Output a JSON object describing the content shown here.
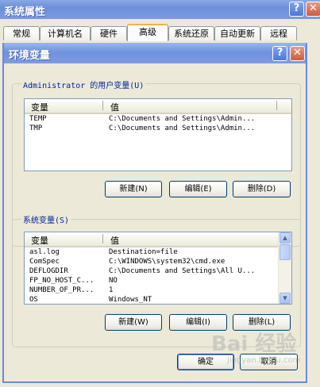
{
  "outer": {
    "title": "系统属性",
    "help": "?",
    "close": "✕",
    "tabs": [
      "常规",
      "计算机名",
      "硬件",
      "高级",
      "系统还原",
      "自动更新",
      "远程"
    ]
  },
  "dialog": {
    "title": "环境变量",
    "help": "?",
    "close": "✕",
    "user_group_label": "Administrator 的用户变量(U)",
    "system_group_label": "系统变量(S)",
    "columns": {
      "name": "变量",
      "value": "值"
    },
    "user_vars": [
      {
        "name": "TEMP",
        "value": "C:\\Documents and Settings\\Admin..."
      },
      {
        "name": "TMP",
        "value": "C:\\Documents and Settings\\Admin..."
      }
    ],
    "system_vars": [
      {
        "name": "asl.log",
        "value": "Destination=file"
      },
      {
        "name": "ComSpec",
        "value": "C:\\WINDOWS\\system32\\cmd.exe"
      },
      {
        "name": "DEFLOGDIR",
        "value": "C:\\Documents and Settings\\All U..."
      },
      {
        "name": "FP_NO_HOST_C...",
        "value": "NO"
      },
      {
        "name": "NUMBER_OF_PR...",
        "value": "1"
      },
      {
        "name": "OS",
        "value": "Windows_NT"
      }
    ],
    "user_buttons": {
      "new": "新建(N)",
      "edit": "编辑(E)",
      "delete": "删除(D)"
    },
    "system_buttons": {
      "new": "新建(W)",
      "edit": "编辑(I)",
      "delete": "删除(L)"
    },
    "ok": "确定",
    "cancel": "取消"
  },
  "watermark": {
    "brand": "Bai 经验",
    "url": "jingyan.baidu.com"
  }
}
